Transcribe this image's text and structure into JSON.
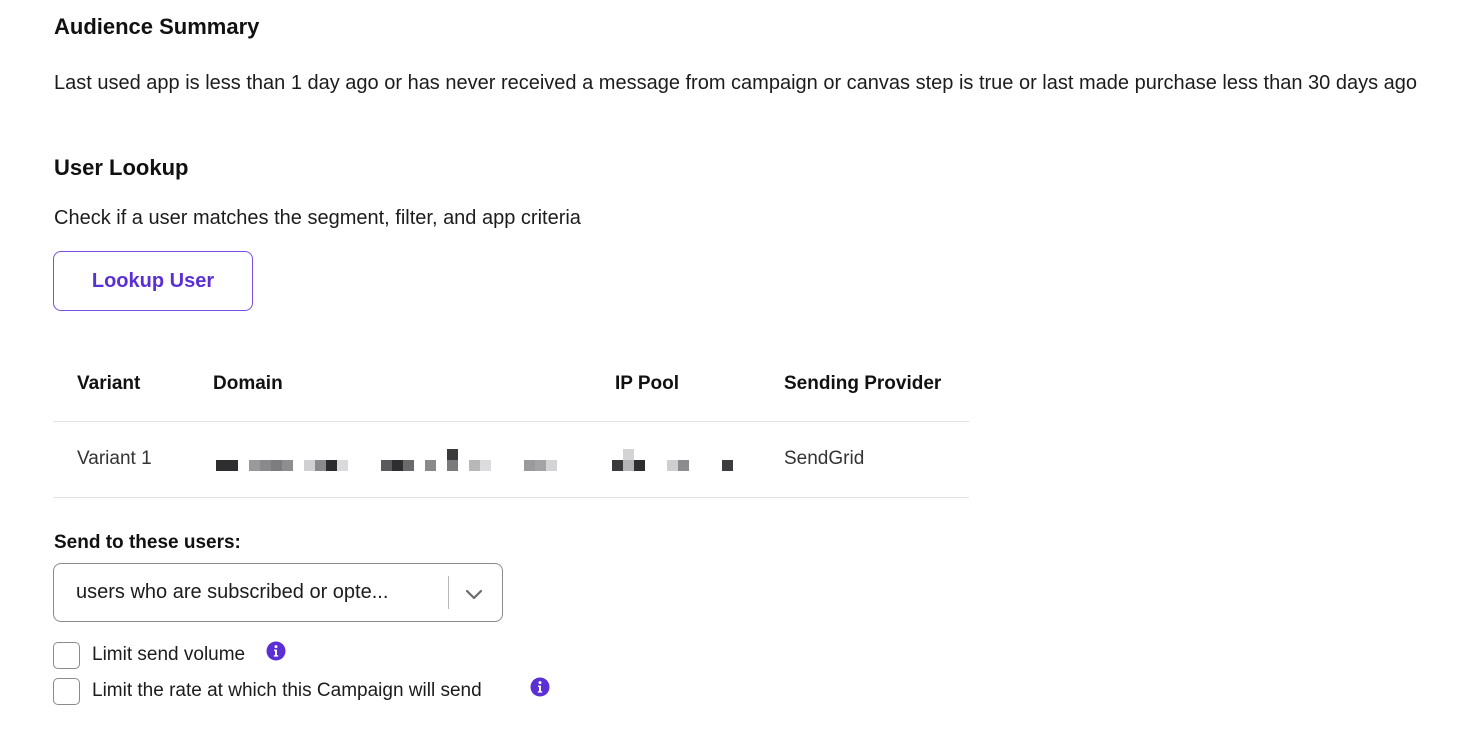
{
  "audience_summary": {
    "heading": "Audience Summary",
    "text": "Last used app is less than 1 day ago or has never received a message from campaign or canvas step is true or last made purchase less than 30 days ago"
  },
  "user_lookup": {
    "heading": "User Lookup",
    "description": "Check if a user matches the segment, filter, and app criteria",
    "button_label": "Lookup User"
  },
  "variant_table": {
    "columns": [
      "Variant",
      "Domain",
      "IP Pool",
      "Sending Provider"
    ],
    "rows": [
      {
        "variant": "Variant 1",
        "domain": "[redacted]",
        "ip_pool": "[redacted]",
        "sending_provider": "SendGrid"
      }
    ]
  },
  "send_to": {
    "label": "Send to these users:",
    "selected_value": "users who are subscribed or opte..."
  },
  "options": {
    "limit_volume": {
      "label": "Limit send volume",
      "checked": false,
      "icon": "info-icon"
    },
    "limit_rate": {
      "label": "Limit the rate at which this Campaign will send",
      "checked": false,
      "icon": "info-icon"
    }
  },
  "colors": {
    "accent": "#5b2fd6",
    "border": "#8a8a90",
    "divider": "#e2e2e6"
  }
}
